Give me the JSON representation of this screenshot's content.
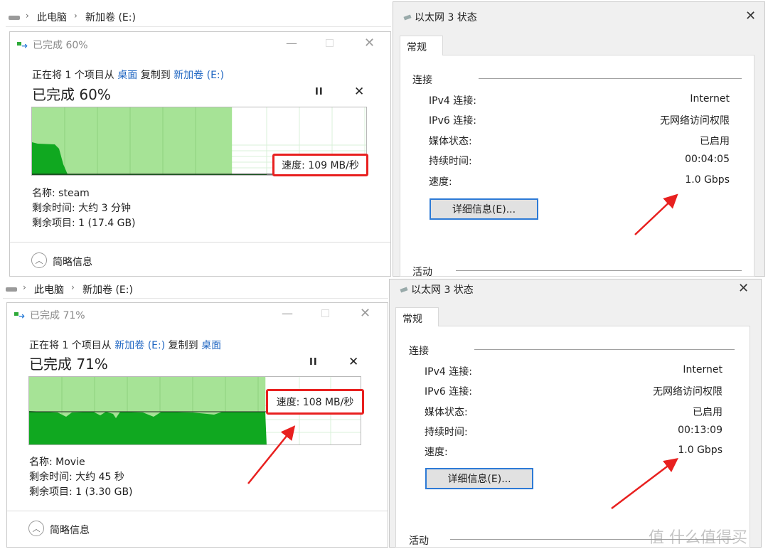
{
  "top": {
    "explorer": {
      "crumbs": [
        "此电脑",
        "新加卷 (E:)"
      ]
    },
    "copy": {
      "title": "已完成 60%",
      "line_prefix": "正在将 1 个项目从",
      "source": "桌面",
      "line_mid": "复制到",
      "dest": "新加卷 (E:)",
      "progress_text": "已完成 60%",
      "progress_percent": 60,
      "speed": "速度: 109 MB/秒",
      "name": "名称: steam",
      "time_left": "剩余时间: 大约 3 分钟",
      "items_left": "剩余项目: 1 (17.4 GB)",
      "collapse": "简略信息"
    },
    "net": {
      "title": "以太网 3 状态",
      "tab": "常规",
      "section_connection": "连接",
      "rows": [
        {
          "label": "IPv4 连接:",
          "value": "Internet"
        },
        {
          "label": "IPv6 连接:",
          "value": "无网络访问权限"
        },
        {
          "label": "媒体状态:",
          "value": "已启用"
        },
        {
          "label": "持续时间:",
          "value": "00:04:05"
        },
        {
          "label": "速度:",
          "value": "1.0 Gbps"
        }
      ],
      "details_button": "详细信息(E)...",
      "section_activity": "活动"
    }
  },
  "bottom": {
    "explorer": {
      "crumbs": [
        "此电脑",
        "新加卷 (E:)"
      ]
    },
    "copy": {
      "title": "已完成 71%",
      "line_prefix": "正在将 1 个项目从",
      "source": "新加卷 (E:)",
      "line_mid": "复制到",
      "dest": "桌面",
      "progress_text": "已完成 71%",
      "progress_percent": 71,
      "speed": "速度: 108 MB/秒",
      "name": "名称: Movie",
      "time_left": "剩余时间: 大约 45 秒",
      "items_left": "剩余项目: 1 (3.30 GB)",
      "collapse": "简略信息"
    },
    "net": {
      "title": "以太网 3 状态",
      "tab": "常规",
      "section_connection": "连接",
      "rows": [
        {
          "label": "IPv4 连接:",
          "value": "Internet"
        },
        {
          "label": "IPv6 连接:",
          "value": "无网络访问权限"
        },
        {
          "label": "媒体状态:",
          "value": "已启用"
        },
        {
          "label": "持续时间:",
          "value": "00:13:09"
        },
        {
          "label": "速度:",
          "value": "1.0 Gbps"
        }
      ],
      "details_button": "详细信息(E)...",
      "section_activity": "活动"
    }
  },
  "colors": {
    "highlight": "#e8201f",
    "graph_fill": "#a6e396",
    "graph_speed": "#10a820",
    "link": "#1f66c2"
  },
  "watermark": "值 什么值得买"
}
